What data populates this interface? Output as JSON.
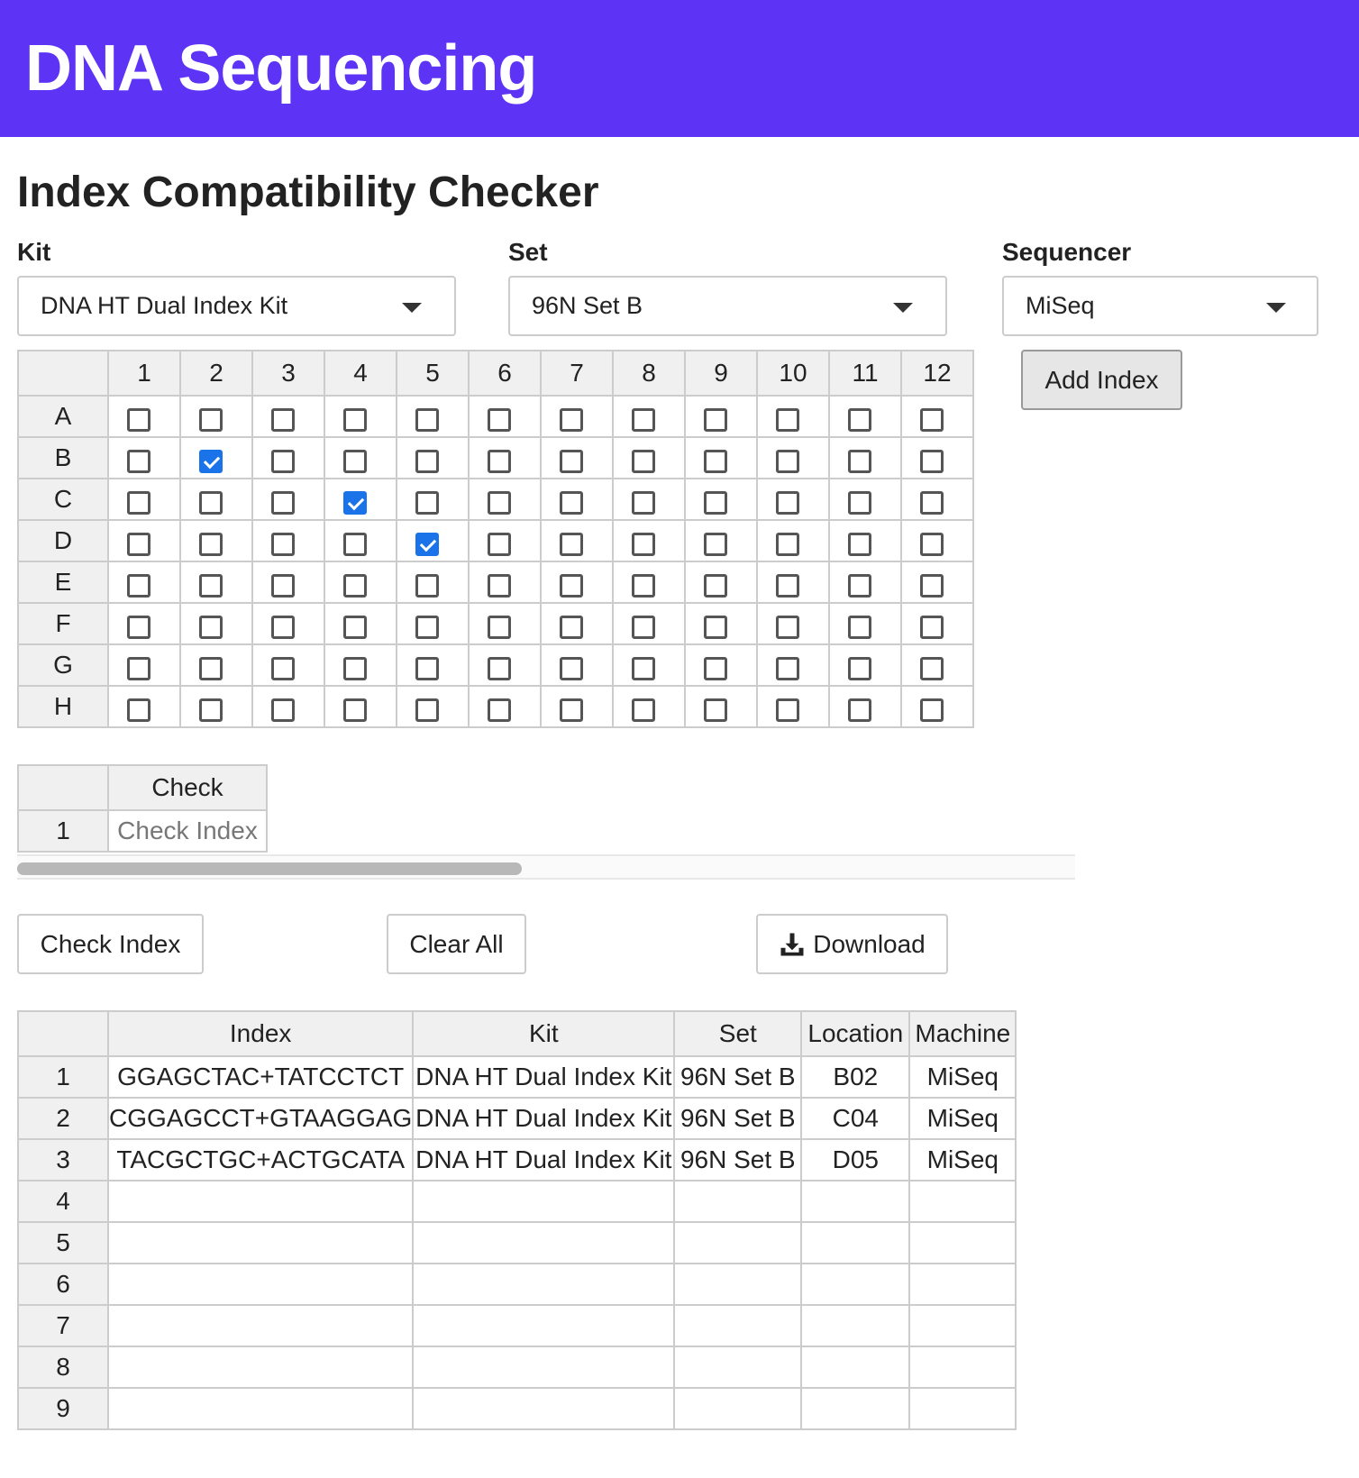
{
  "header": {
    "title": "DNA Sequencing"
  },
  "page": {
    "title": "Index Compatibility Checker"
  },
  "kit": {
    "label": "Kit",
    "value": "DNA HT Dual Index Kit"
  },
  "set": {
    "label": "Set",
    "value": "96N Set B"
  },
  "sequencer": {
    "label": "Sequencer",
    "value": "MiSeq"
  },
  "add_index_label": "Add Index",
  "plate": {
    "columns": [
      "1",
      "2",
      "3",
      "4",
      "5",
      "6",
      "7",
      "8",
      "9",
      "10",
      "11",
      "12"
    ],
    "rows": [
      "A",
      "B",
      "C",
      "D",
      "E",
      "F",
      "G",
      "H"
    ],
    "checked": [
      "B2",
      "C4",
      "D5"
    ]
  },
  "check_table": {
    "header": "Check",
    "row_label": "1",
    "value": "Check Index"
  },
  "buttons": {
    "check_index": "Check Index",
    "clear_all": "Clear All",
    "download": "Download",
    "download_icon": "download-icon"
  },
  "results": {
    "headers": [
      "Index",
      "Kit",
      "Set",
      "Location",
      "Machine"
    ],
    "rows": [
      [
        "1",
        "GGAGCTAC+TATCCTCT",
        "DNA HT Dual Index Kit",
        "96N Set B",
        "B02",
        "MiSeq"
      ],
      [
        "2",
        "CGGAGCCT+GTAAGGAG",
        "DNA HT Dual Index Kit",
        "96N Set B",
        "C04",
        "MiSeq"
      ],
      [
        "3",
        "TACGCTGC+ACTGCATA",
        "DNA HT Dual Index Kit",
        "96N Set B",
        "D05",
        "MiSeq"
      ],
      [
        "4",
        "",
        "",
        "",
        "",
        ""
      ],
      [
        "5",
        "",
        "",
        "",
        "",
        ""
      ],
      [
        "6",
        "",
        "",
        "",
        "",
        ""
      ],
      [
        "7",
        "",
        "",
        "",
        "",
        ""
      ],
      [
        "8",
        "",
        "",
        "",
        "",
        ""
      ],
      [
        "9",
        "",
        "",
        "",
        "",
        ""
      ]
    ]
  },
  "colors": {
    "header_bg": "#5d33f6",
    "checkbox_checked": "#1a73e8"
  }
}
